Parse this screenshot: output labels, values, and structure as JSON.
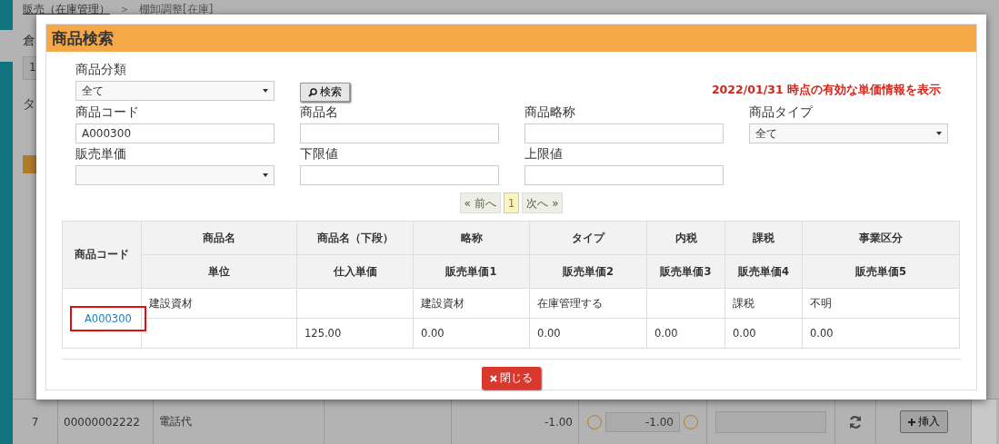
{
  "background": {
    "breadcrumb": [
      {
        "label": "販売（在庫管理）",
        "kind": "link"
      },
      {
        "label": "＞",
        "kind": "separator"
      },
      {
        "label": "棚卸調整[在庫]",
        "kind": "text"
      }
    ],
    "labels": [
      "倉",
      "タ"
    ],
    "field_value": "1",
    "row": {
      "no": "7",
      "code": "00000002222",
      "name": "電話代",
      "amount": "-1.00",
      "quantity": "-1.00",
      "insert_button": "挿入"
    }
  },
  "dialog": {
    "title": "商品検索",
    "note": "2022/01/31 時点の有効な単価情報を表示",
    "search_button": "検索",
    "fields": [
      {
        "label": "商品分類",
        "kind": "select",
        "value": "全て"
      },
      {
        "label": "商品コード",
        "kind": "text",
        "value": "A000300"
      },
      {
        "label": "商品名",
        "kind": "text"
      },
      {
        "label": "商品略称",
        "kind": "text"
      },
      {
        "label": "商品タイプ",
        "kind": "select",
        "value": "全て"
      },
      {
        "label": "販売単価",
        "kind": "select"
      },
      {
        "label": "下限値",
        "kind": "text"
      },
      {
        "label": "上限値",
        "kind": "text"
      }
    ],
    "pagination": {
      "prev": "« 前へ",
      "pages": [
        {
          "label": "1",
          "selected": true
        }
      ],
      "next": "次へ »"
    },
    "table": {
      "first_column": "商品コード",
      "header_row_1": [
        "商品名",
        "商品名（下段）",
        "略称",
        "タイプ",
        "内税",
        "課税",
        "事業区分"
      ],
      "header_row_2": [
        "単位",
        "仕入単価",
        "販売単価1",
        "販売単価2",
        "販売単価3",
        "販売単価4",
        "販売単価5"
      ],
      "rows": [
        {
          "code": "A000300",
          "selected": true,
          "line_1": {
            "name": "建設資材",
            "short_name": "建設資材",
            "type": "在庫管理する",
            "taxable": "課税",
            "business_category": "不明"
          },
          "line_2": {
            "purchase_price": "125.00",
            "price_1": "0.00",
            "price_2": "0.00",
            "price_3": "0.00",
            "price_4": "0.00",
            "price_5": "0.00"
          }
        }
      ]
    },
    "close_button": "閉じる"
  }
}
